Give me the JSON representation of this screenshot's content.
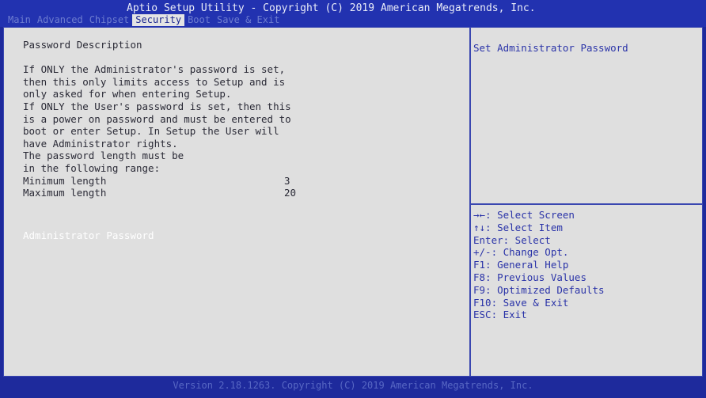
{
  "header": {
    "title": "Aptio Setup Utility - Copyright (C) 2019 American Megatrends, Inc.",
    "tabs": [
      {
        "label": "Main",
        "active": false
      },
      {
        "label": "Advanced",
        "active": false
      },
      {
        "label": "Chipset",
        "active": false
      },
      {
        "label": "Security",
        "active": true
      },
      {
        "label": "Boot",
        "active": false
      },
      {
        "label": "Save & Exit",
        "active": false
      }
    ]
  },
  "main": {
    "heading": "Password Description",
    "description": [
      "If ONLY the Administrator's password is set,",
      "then this only limits access to Setup and is",
      "only asked for when entering Setup.",
      "If ONLY the User's password is set, then this",
      "is a power on password and must be entered to",
      "boot or enter Setup. In Setup the User will",
      "have Administrator rights.",
      "The password length must be",
      "in the following range:"
    ],
    "min_label": "Minimum length",
    "min_value": "3",
    "max_label": "Maximum length",
    "max_value": "20",
    "admin_password_label": "Administrator Password"
  },
  "help": {
    "text": "Set Administrator Password"
  },
  "keys": [
    "→←: Select Screen",
    "↑↓: Select Item",
    "Enter: Select",
    "+/-: Change Opt.",
    "F1: General Help",
    "F8: Previous Values",
    "F9: Optimized Defaults",
    "F10: Save & Exit",
    "ESC: Exit"
  ],
  "footer": {
    "version": "Version 2.18.1263. Copyright (C) 2019 American Megatrends, Inc."
  },
  "colors": {
    "background": "#1e2a9c",
    "panel": "#dfdfdf",
    "accent": "#2a33a8",
    "highlight_text": "#ffffff"
  }
}
